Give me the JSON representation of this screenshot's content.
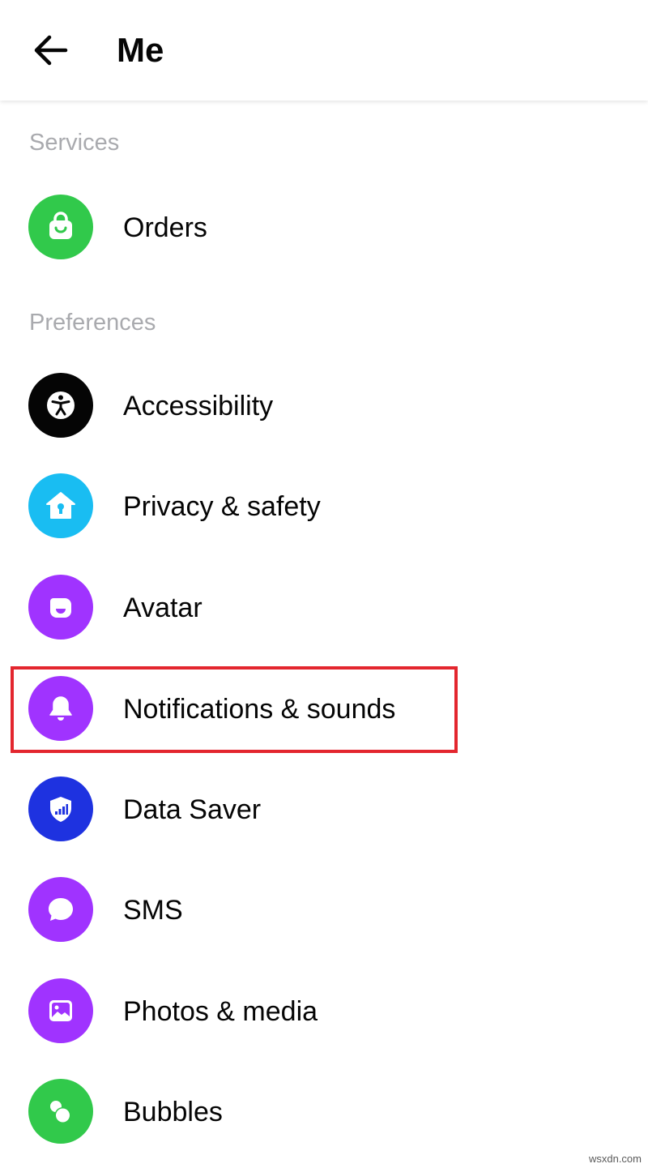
{
  "header": {
    "title": "Me",
    "back_icon": "arrow-left-icon"
  },
  "sections": {
    "services": "Services",
    "preferences": "Preferences"
  },
  "items": {
    "orders": {
      "label": "Orders",
      "icon": "shopping-bag-icon",
      "color": "#31c94b"
    },
    "accessibility": {
      "label": "Accessibility",
      "icon": "accessibility-person-icon",
      "color": "#050505"
    },
    "privacy": {
      "label": "Privacy & safety",
      "icon": "home-keyhole-icon",
      "color": "#19bdf2"
    },
    "avatar": {
      "label": "Avatar",
      "icon": "avatar-face-icon",
      "color": "#a033ff"
    },
    "notifications": {
      "label": "Notifications & sounds",
      "icon": "bell-icon",
      "color": "#a033ff"
    },
    "data_saver": {
      "label": "Data Saver",
      "icon": "shield-signal-icon",
      "color": "#1e32e0"
    },
    "sms": {
      "label": "SMS",
      "icon": "chat-bubble-icon",
      "color": "#a033ff"
    },
    "photos": {
      "label": "Photos & media",
      "icon": "image-icon",
      "color": "#a033ff"
    },
    "bubbles": {
      "label": "Bubbles",
      "icon": "bubbles-icon",
      "color": "#31c94b"
    }
  },
  "highlight_color": "#e3262e",
  "watermark": "wsxdn.com"
}
